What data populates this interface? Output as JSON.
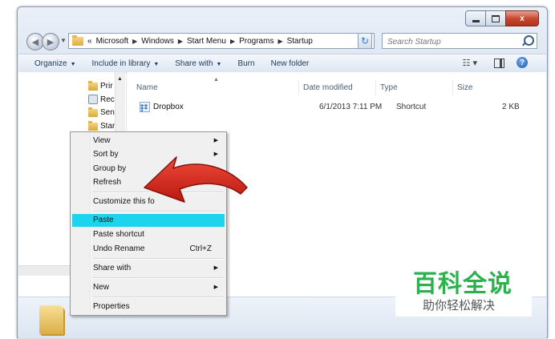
{
  "window": {
    "caption_buttons": {
      "minimize": "minimize-icon",
      "maximize": "maximize-icon",
      "close_label": "x"
    }
  },
  "address_bar": {
    "overflow": "«",
    "crumbs": [
      "Microsoft",
      "Windows",
      "Start Menu",
      "Programs",
      "Startup"
    ]
  },
  "search": {
    "placeholder": "Search Startup"
  },
  "command_bar": {
    "items": [
      "Organize",
      "Include in library",
      "Share with",
      "Burn",
      "New folder"
    ]
  },
  "nav_pane": {
    "items": [
      "Prir",
      "Rec",
      "Sen",
      "Star"
    ]
  },
  "file_list": {
    "columns": [
      "Name",
      "Date modified",
      "Type",
      "Size"
    ],
    "rows": [
      {
        "name": "Dropbox",
        "date": "6/1/2013 7:11 PM",
        "type": "Shortcut",
        "size": "2 KB"
      }
    ]
  },
  "context_menu": {
    "items": [
      {
        "label": "View",
        "submenu": true
      },
      {
        "label": "Sort by",
        "submenu": true
      },
      {
        "label": "Group by",
        "submenu": true
      },
      {
        "label": "Refresh"
      },
      {
        "label": "Customize this fo"
      },
      {
        "label": "Paste",
        "highlighted": true
      },
      {
        "label": "Paste shortcut"
      },
      {
        "label": "Undo Rename",
        "shortcut": "Ctrl+Z"
      },
      {
        "label": "Share with",
        "submenu": true
      },
      {
        "label": "New",
        "submenu": true
      },
      {
        "label": "Properties"
      }
    ]
  },
  "watermark": {
    "title": "百科全说",
    "subtitle": "助你轻松解决"
  },
  "colors": {
    "highlight": "#1cd4ee",
    "annotation_arrow": "#d6261c",
    "watermark_green": "#2bb24c"
  }
}
